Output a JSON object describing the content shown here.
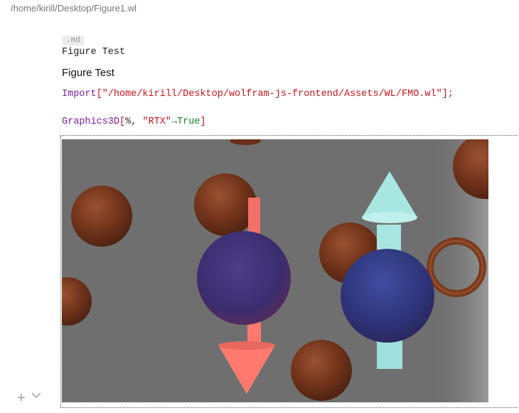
{
  "window": {
    "path": "/home/kirill/Desktop/Figure1.wl"
  },
  "md_cell": {
    "tag": ".md",
    "source": "Figure Test",
    "output": "Figure Test"
  },
  "import_cell": {
    "func": "Import",
    "open": "[",
    "arg": "\"/home/kirill/Desktop/wolfram-js-frontend/Assets/WL/FMO.wl\"",
    "close": "];"
  },
  "graphics_cell": {
    "func": "Graphics3D",
    "open": "[",
    "arg1": "%, ",
    "opt": "\"RTX\"",
    "arrow": "→",
    "val": "True",
    "close": "]"
  },
  "controls": {
    "add": "+",
    "icons": [
      "plus-icon",
      "chevron-down-icon"
    ]
  },
  "colors": {
    "background": "#6f6f6f",
    "atom": "#7a3a1e",
    "up_arrow": "#a8e6e2",
    "down_arrow": "#ff7a6e",
    "core": "#3a2f73"
  }
}
